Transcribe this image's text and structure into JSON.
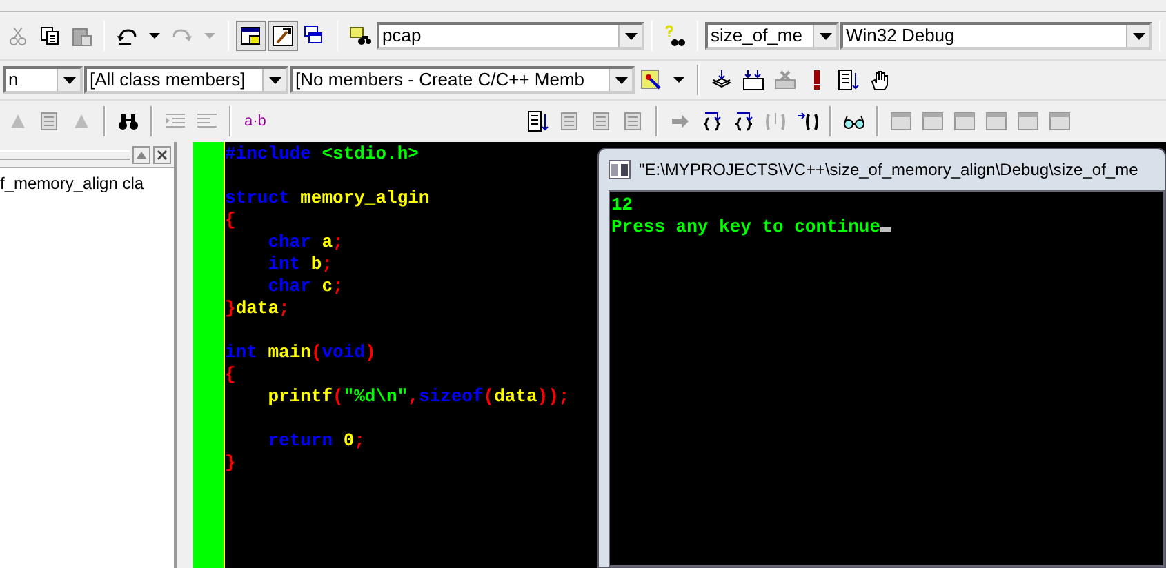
{
  "toolbar": {
    "project_combo": "pcap",
    "target_combo": "size_of_me",
    "config_combo": "Win32 Debug",
    "class_combo": "n",
    "members_combo": "[All class members]",
    "member_combo": "[No members - Create C/C++ Memb",
    "label_tool": "a·b"
  },
  "class_panel": {
    "item": "f_memory_align cla"
  },
  "editor": {
    "lines": [
      {
        "kind": "code",
        "indented": false,
        "tokens": [
          {
            "kind": "keyword",
            "text": "#include "
          },
          {
            "kind": "string",
            "text": "<stdio.h>"
          }
        ]
      },
      {
        "kind": "blank"
      },
      {
        "kind": "code",
        "indented": false,
        "tokens": [
          {
            "kind": "keyword",
            "text": "struct "
          },
          {
            "kind": "ident",
            "text": "memory_algin"
          }
        ]
      },
      {
        "kind": "code",
        "indented": false,
        "tokens": [
          {
            "kind": "punct",
            "text": "{"
          }
        ]
      },
      {
        "kind": "code",
        "indented": true,
        "tokens": [
          {
            "kind": "keyword",
            "text": "char "
          },
          {
            "kind": "ident",
            "text": "a"
          },
          {
            "kind": "punct",
            "text": ";"
          }
        ]
      },
      {
        "kind": "code",
        "indented": true,
        "tokens": [
          {
            "kind": "keyword",
            "text": "int "
          },
          {
            "kind": "ident",
            "text": "b"
          },
          {
            "kind": "punct",
            "text": ";"
          }
        ]
      },
      {
        "kind": "code",
        "indented": true,
        "tokens": [
          {
            "kind": "keyword",
            "text": "char "
          },
          {
            "kind": "ident",
            "text": "c"
          },
          {
            "kind": "punct",
            "text": ";"
          }
        ]
      },
      {
        "kind": "code",
        "indented": false,
        "tokens": [
          {
            "kind": "punct",
            "text": "}"
          },
          {
            "kind": "ident",
            "text": "data"
          },
          {
            "kind": "punct",
            "text": ";"
          }
        ]
      },
      {
        "kind": "blank"
      },
      {
        "kind": "code",
        "indented": false,
        "tokens": [
          {
            "kind": "keyword",
            "text": "int "
          },
          {
            "kind": "ident",
            "text": "main"
          },
          {
            "kind": "punct",
            "text": "("
          },
          {
            "kind": "keyword",
            "text": "void"
          },
          {
            "kind": "punct",
            "text": ")"
          }
        ]
      },
      {
        "kind": "code",
        "indented": false,
        "tokens": [
          {
            "kind": "punct",
            "text": "{"
          }
        ]
      },
      {
        "kind": "code",
        "indented": true,
        "tokens": [
          {
            "kind": "ident",
            "text": "printf"
          },
          {
            "kind": "punct",
            "text": "("
          },
          {
            "kind": "string",
            "text": "\"%d\\n\""
          },
          {
            "kind": "punct",
            "text": ","
          },
          {
            "kind": "keyword",
            "text": "sizeof"
          },
          {
            "kind": "punct",
            "text": "("
          },
          {
            "kind": "ident",
            "text": "data"
          },
          {
            "kind": "punct",
            "text": "));"
          }
        ]
      },
      {
        "kind": "blank"
      },
      {
        "kind": "code",
        "indented": true,
        "tokens": [
          {
            "kind": "keyword",
            "text": "return "
          },
          {
            "kind": "number",
            "text": "0"
          },
          {
            "kind": "punct",
            "text": ";"
          }
        ]
      },
      {
        "kind": "code",
        "indented": false,
        "tokens": [
          {
            "kind": "punct",
            "text": "}"
          }
        ]
      }
    ]
  },
  "console": {
    "title": "\"E:\\MYPROJECTS\\VC++\\size_of_memory_align\\Debug\\size_of_me",
    "output": [
      "12",
      "Press any key to continue"
    ]
  }
}
